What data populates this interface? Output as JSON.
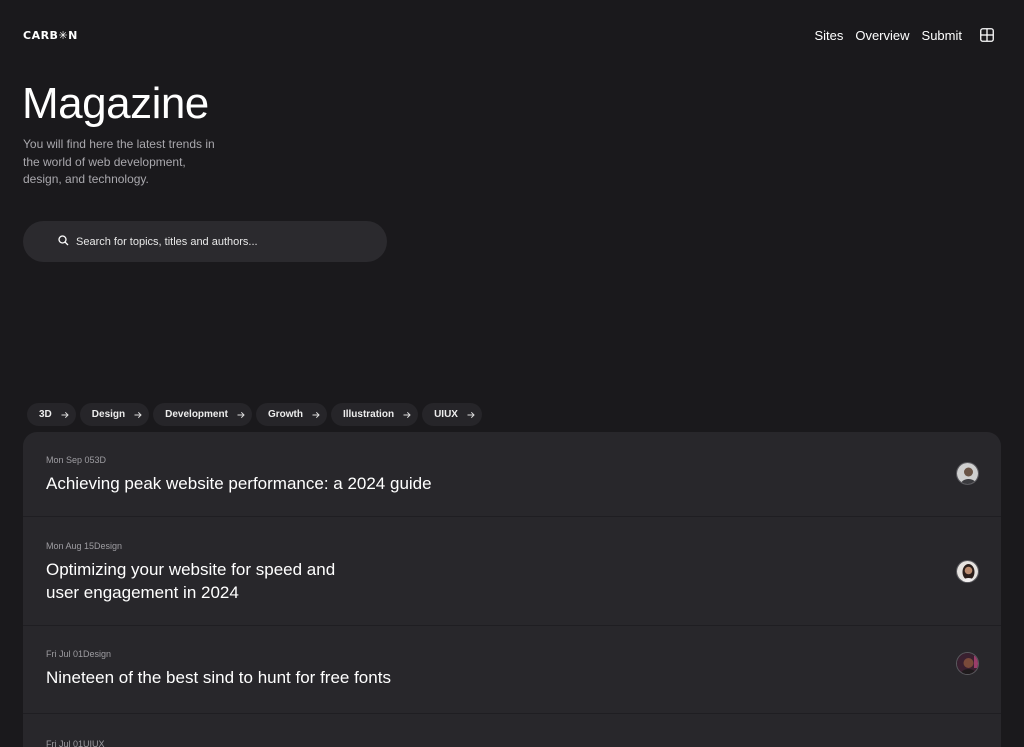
{
  "header": {
    "logo": "CARB✳N",
    "nav": [
      "Sites",
      "Overview",
      "Submit"
    ],
    "grid_icon": "grid-icon"
  },
  "hero": {
    "title": "Magazine",
    "description": "You will find here the latest trends in the world of web development, design, and technology."
  },
  "search": {
    "placeholder": "Search for topics, titles and authors...",
    "icon": "search-icon"
  },
  "tags": [
    "3D",
    "Design",
    "Development",
    "Growth",
    "Illustration",
    "UIUX"
  ],
  "articles": [
    {
      "meta": "Mon Sep 053D",
      "title": "Achieving peak website performance: a 2024 guide"
    },
    {
      "meta": "Mon Aug 15Design",
      "title": "Optimizing your website for speed and user engagement in 2024"
    },
    {
      "meta": "Fri Jul 01Design",
      "title": "Nineteen of the best sind to hunt for free fonts"
    },
    {
      "meta": "Fri Jul 01UIUX",
      "title": ""
    }
  ],
  "colors": {
    "background": "#1a191c",
    "card": "#28272b",
    "search": "#2b2a2e",
    "muted_text": "#a9a8ad"
  }
}
